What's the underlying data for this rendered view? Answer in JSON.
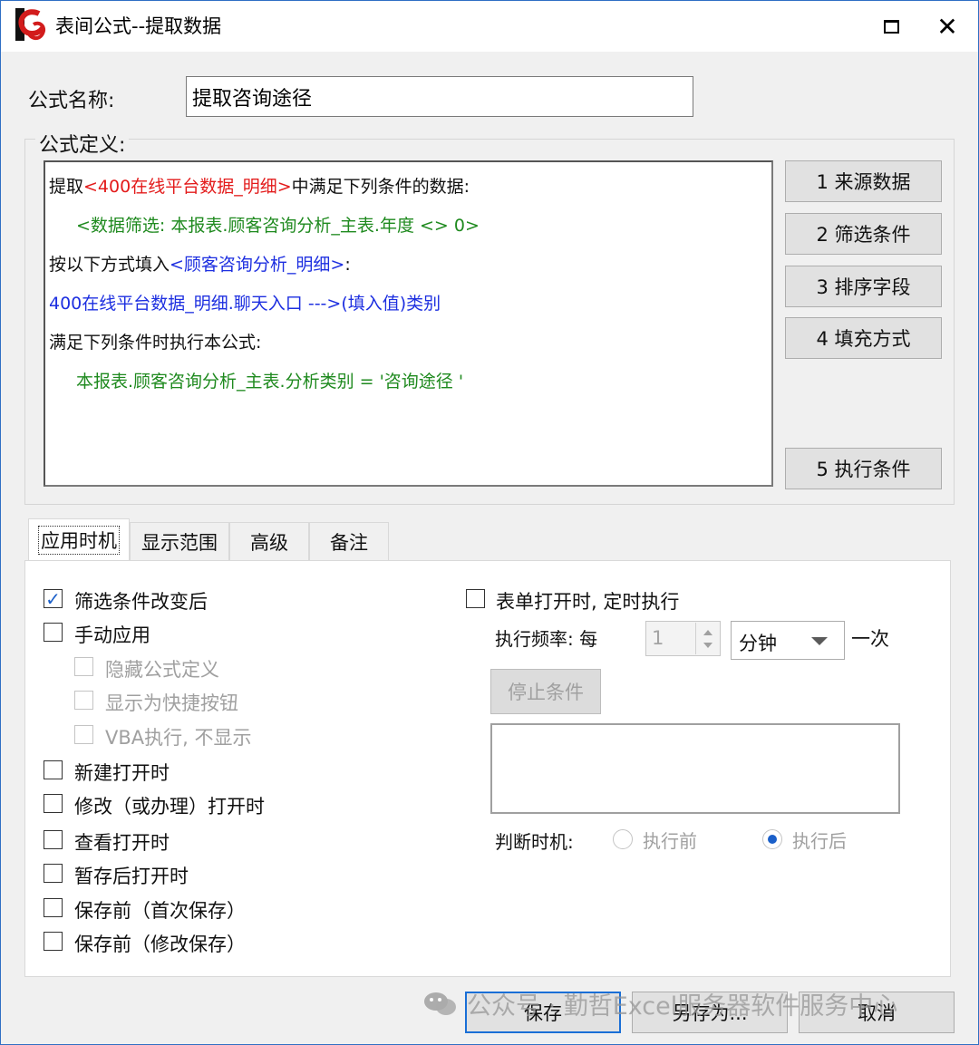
{
  "window": {
    "title": "表间公式--提取数据",
    "maximize_glyph": "□",
    "close_glyph": "✕"
  },
  "name_field": {
    "label": "公式名称:",
    "value": "提取咨询途径"
  },
  "definition": {
    "group_title": "公式定义:",
    "line1_a": "提取",
    "line1_b": "<400在线平台数据_明细>",
    "line1_c": "中满足下列条件的数据:",
    "line2": "<数据筛选: 本报表.顾客咨询分析_主表.年度 <> 0>",
    "line3_a": "按以下方式填入",
    "line3_b": "<顾客咨询分析_明细>",
    "line3_c": ":",
    "line4": "400在线平台数据_明细.聊天入口  --->(填入值)类别",
    "line5": "满足下列条件时执行本公式:",
    "line6": "本报表.顾客咨询分析_主表.分析类别 = '咨询途径 '"
  },
  "side_buttons": {
    "b1": "1  来源数据",
    "b2": "2  筛选条件",
    "b3": "3  排序字段",
    "b4": "4 填充方式",
    "b5": "5 执行条件"
  },
  "tabs": {
    "t1": "应用时机",
    "t2": "显示范围",
    "t3": "高级",
    "t4": "备注"
  },
  "options": {
    "filter_changed": {
      "label": "筛选条件改变后",
      "checked": true
    },
    "manual_apply": {
      "label": "手动应用",
      "checked": false
    },
    "hide_def": {
      "label": "隐藏公式定义",
      "checked": false
    },
    "show_shortcut": {
      "label": "显示为快捷按钮",
      "checked": false
    },
    "vba_exec": {
      "label": "VBA执行, 不显示",
      "checked": false
    },
    "new_open": {
      "label": "新建打开时",
      "checked": false
    },
    "modify_open": {
      "label": "修改（或办理）打开时",
      "checked": false
    },
    "view_open": {
      "label": "查看打开时",
      "checked": false
    },
    "draft_open": {
      "label": "暂存后打开时",
      "checked": false
    },
    "before_save_first": {
      "label": "保存前（首次保存）",
      "checked": false
    },
    "before_save_modify": {
      "label": "保存前（修改保存）",
      "checked": false
    }
  },
  "timer": {
    "label": "表单打开时, 定时执行",
    "checked": false,
    "freq_label": "执行频率: 每",
    "freq_value": "1",
    "unit": "分钟",
    "suffix": "一次",
    "stop_button": "停止条件",
    "judge_label": "判断时机:",
    "before_label": "执行前",
    "after_label": "执行后",
    "selected": "执行后"
  },
  "bottom": {
    "save": "保存",
    "save_as": "另存为...",
    "cancel": "取消"
  },
  "watermark": "公众号 · 勤哲Excel服务器软件服务中心",
  "colors": {
    "red": "#e31b1b",
    "green": "#1f8a1f",
    "blue": "#1d2fe0",
    "accent": "#1a5fc9"
  }
}
